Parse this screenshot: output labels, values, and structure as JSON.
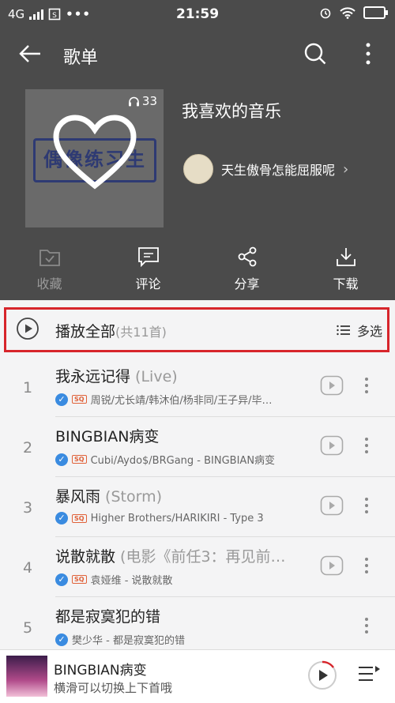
{
  "status_bar": {
    "network": "4G",
    "time": "21:59"
  },
  "app_bar": {
    "title": "歌单"
  },
  "playlist": {
    "name": "我喜欢的音乐",
    "play_count": "33",
    "cover_text": "偶像练习生",
    "creator": "天生傲骨怎能屈服呢"
  },
  "actions": [
    {
      "label": "收藏"
    },
    {
      "label": "评论"
    },
    {
      "label": "分享"
    },
    {
      "label": "下载"
    }
  ],
  "play_all": {
    "label": "播放全部",
    "count": "(共11首)",
    "multi_select": "多选"
  },
  "songs": [
    {
      "num": "1",
      "title": "我永远记得",
      "subtitle": " (Live)",
      "badge": "SQ",
      "meta": "周锐/尤长靖/韩沐伯/杨非同/王子异/毕…"
    },
    {
      "num": "2",
      "title": "BINGBIAN病变",
      "subtitle": "",
      "badge": "SQ",
      "meta": "Cubi/Aydo$/BRGang - BINGBIAN病变"
    },
    {
      "num": "3",
      "title": "暴风雨",
      "subtitle": " (Storm)",
      "badge": "SQ",
      "meta": "Higher Brothers/HARIKIRI - Type 3"
    },
    {
      "num": "4",
      "title": "说散就散",
      "subtitle": " (电影《前任3：再见前…",
      "badge": "SQ",
      "meta": "袁娅维 - 说散就散"
    },
    {
      "num": "5",
      "title": "都是寂寞犯的错",
      "subtitle": "",
      "badge": "",
      "meta": "樊少华 - 都是寂寞犯的错"
    }
  ],
  "now_playing": {
    "title": "BINGBIAN病变",
    "hint": "横滑可以切换上下首哦"
  },
  "colors": {
    "header_bg": "#4b4b4b",
    "highlight_border": "#d7252b",
    "verified_blue": "#3a8be0",
    "sq_orange": "#e0623a"
  }
}
